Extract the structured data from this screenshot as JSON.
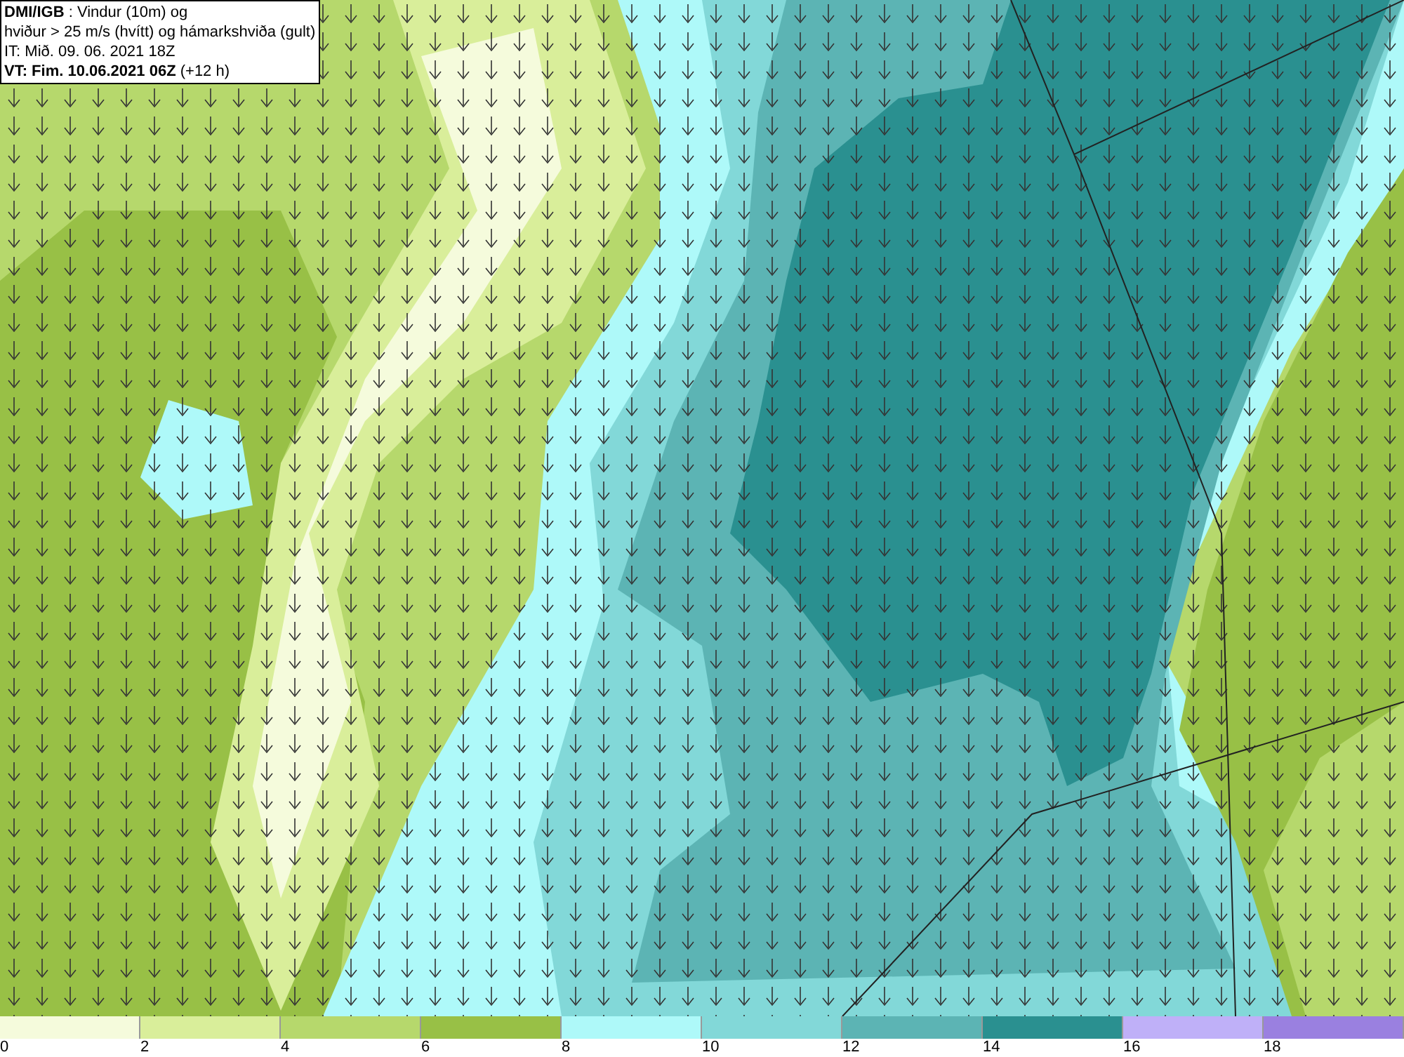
{
  "header": {
    "lines": [
      "**DMI/IGB** : Vindur (10m) og",
      "hviður > 25 m/s (hvítt) og hámarkshviða (gult)",
      "IT: Mið. 09. 06. 2021 18Z",
      "**VT: Fim. 10.06.2021 06Z** (+12 h)"
    ]
  },
  "legend": [
    {
      "label": "0",
      "color": "#f5fbdc"
    },
    {
      "label": "2",
      "color": "#d9ee9a"
    },
    {
      "label": "4",
      "color": "#b6d86c"
    },
    {
      "label": "6",
      "color": "#98c046"
    },
    {
      "label": "8",
      "color": "#aef9f9"
    },
    {
      "label": "10",
      "color": "#82d8d8"
    },
    {
      "label": "12",
      "color": "#5cb4b4"
    },
    {
      "label": "14",
      "color": "#2a9090"
    },
    {
      "label": "16",
      "color": "#bfb0f8"
    },
    {
      "label": "18",
      "color": "#9a80e0"
    }
  ]
}
